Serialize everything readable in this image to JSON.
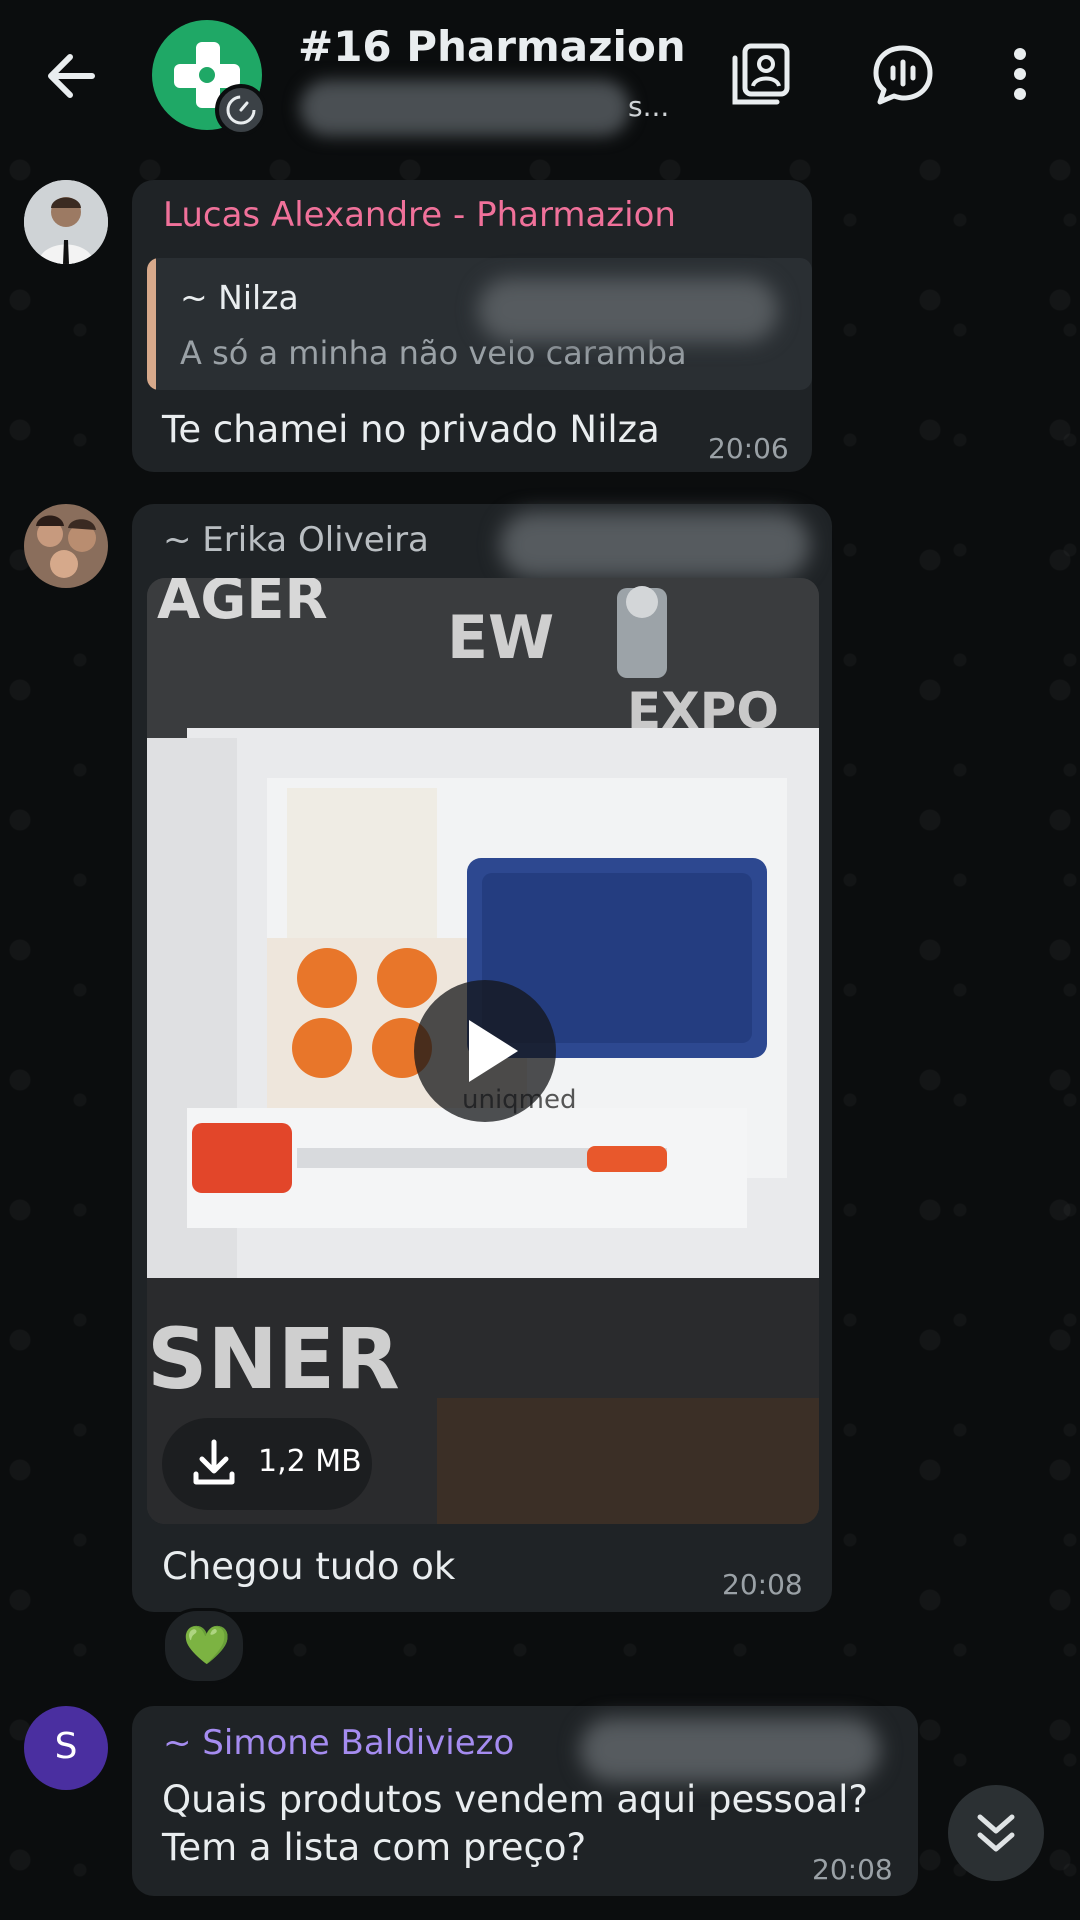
{
  "header": {
    "title": "#16 Pharmazion",
    "subtitle_tail": "s..."
  },
  "messages": [
    {
      "sender": "Lucas Alexandre - Pharmazion",
      "sender_color": "#f0719a",
      "quote": {
        "author": "~ Nilza",
        "text": "A só a minha não veio caramba"
      },
      "text": "Te chamei no privado Nilza",
      "time": "20:06"
    },
    {
      "sender": "~ Erika Oliveira",
      "sender_color": "#b9bec2",
      "media": {
        "type": "video",
        "size": "1,2 MB",
        "brand_label": "uniqmed"
      },
      "text": "Chegou tudo  ok",
      "time": "20:08",
      "reaction": "💚"
    },
    {
      "sender": "~ Simone Baldiviezo",
      "sender_color": "#a58cf0",
      "avatar_letter": "S",
      "avatar_color": "#4a2fa0",
      "text_lines": [
        "Quais produtos vendem aqui pessoal?",
        "Tem a lista com preço?"
      ],
      "time": "20:08"
    }
  ],
  "icons": {
    "back": "arrow-left-icon",
    "gallery": "media-gallery-icon",
    "voice_chat": "voice-chat-icon",
    "more": "more-vertical-icon",
    "play": "play-icon",
    "download": "download-icon",
    "scroll_down": "double-chevron-down-icon"
  }
}
